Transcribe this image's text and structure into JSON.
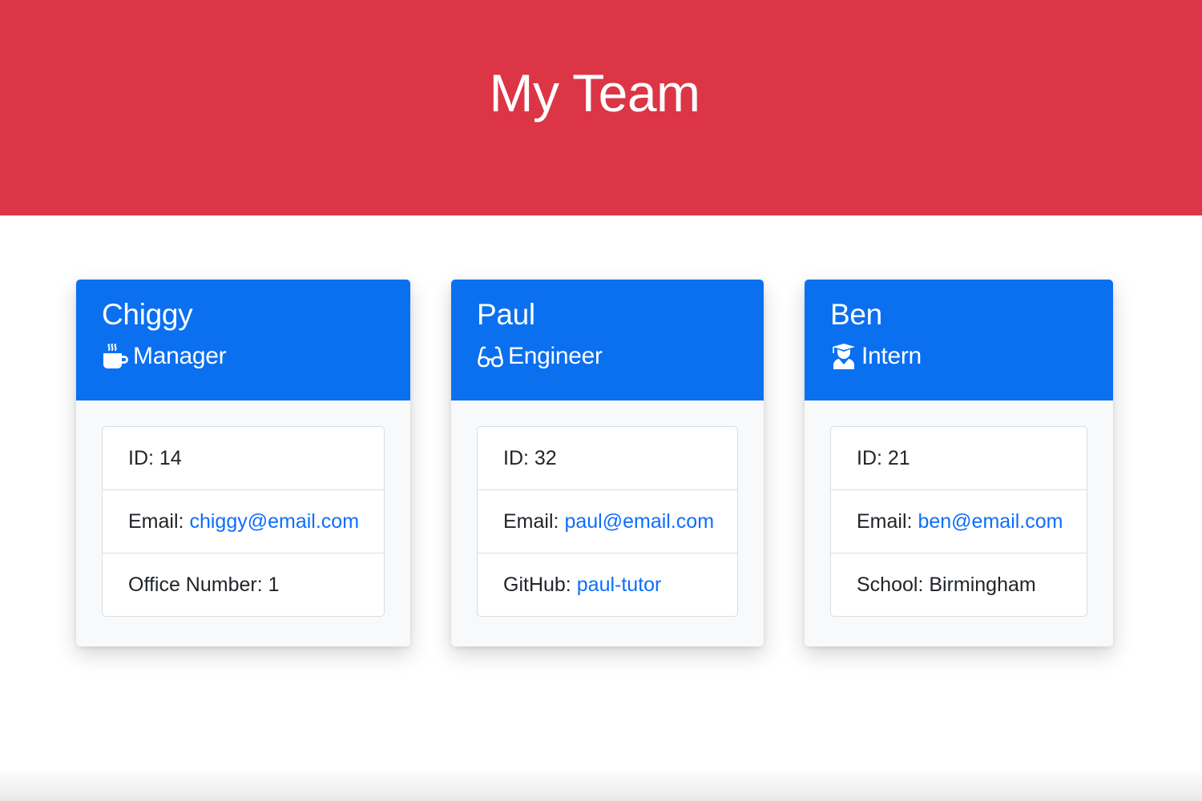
{
  "header": {
    "title": "My Team",
    "background_color": "#dc3545"
  },
  "theme": {
    "card_header_color": "#0a70f0",
    "link_color": "#0d6efd"
  },
  "cards": [
    {
      "name": "Chiggy",
      "role": "Manager",
      "role_icon": "mug-hot-icon",
      "id_label": "ID:",
      "id": "14",
      "email_label": "Email:",
      "email": "chiggy@email.com",
      "extra_label": "Office Number:",
      "extra_value": "1"
    },
    {
      "name": "Paul",
      "role": "Engineer",
      "role_icon": "glasses-icon",
      "id_label": "ID:",
      "id": "32",
      "email_label": "Email:",
      "email": "paul@email.com",
      "extra_label": "GitHub:",
      "extra_value": "paul-tutor"
    },
    {
      "name": "Ben",
      "role": "Intern",
      "role_icon": "graduate-icon",
      "id_label": "ID:",
      "id": "21",
      "email_label": "Email:",
      "email": "ben@email.com",
      "extra_label": "School:",
      "extra_value": "Birmingham"
    }
  ]
}
